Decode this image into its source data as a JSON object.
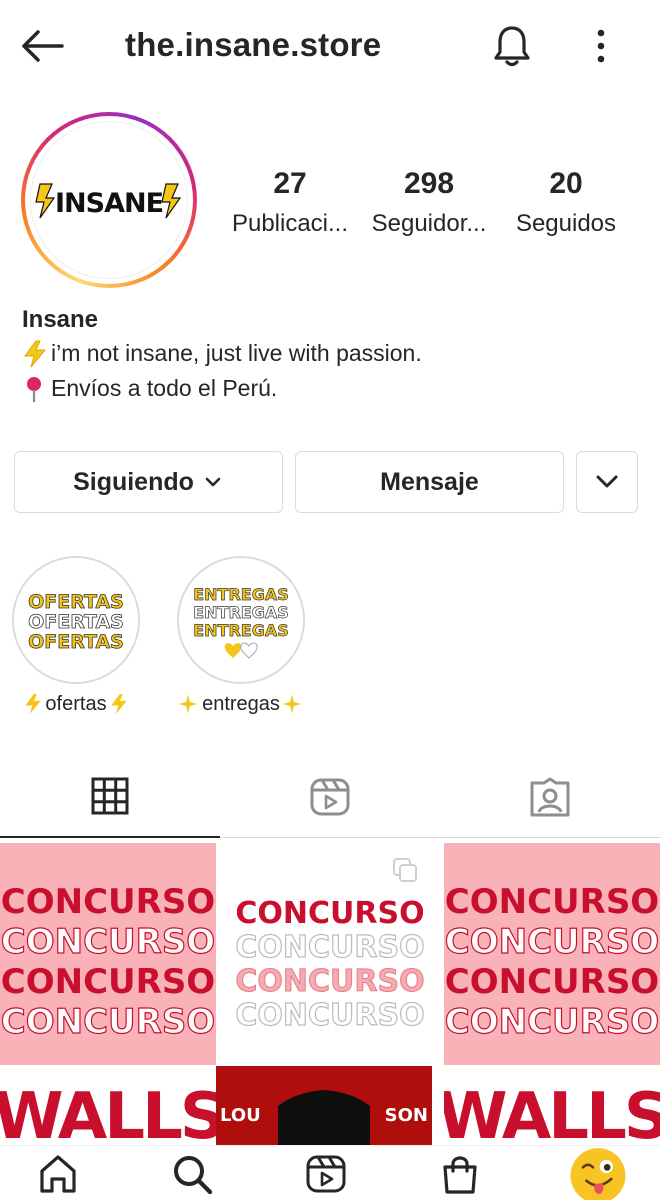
{
  "header": {
    "username": "the.insane.store"
  },
  "profile": {
    "avatar_text": "INSANE",
    "stats": [
      {
        "value": "27",
        "label": "Publicaci..."
      },
      {
        "value": "298",
        "label": "Seguidor..."
      },
      {
        "value": "20",
        "label": "Seguidos"
      }
    ],
    "name": "Insane",
    "bio_line_1": "i’m not insane, just live with passion.",
    "bio_line_2": "Envíos a todo el Perú."
  },
  "buttons": {
    "following": "Siguiendo",
    "message": "Mensaje"
  },
  "highlights": [
    {
      "label": "ofertas",
      "cover_text": "OFERTAS"
    },
    {
      "label": "entregas",
      "cover_text": "ENTREGAS"
    }
  ],
  "tabs": [
    "grid-icon",
    "reels-icon",
    "tagged-icon"
  ],
  "posts": [
    {
      "text": "CONCURSO"
    },
    {
      "text": "CONCURSO"
    },
    {
      "text": "CONCURSO"
    }
  ],
  "posts_row2": [
    {
      "text": "WALLS"
    },
    {
      "text_left": "LOU",
      "text_right": "SON"
    },
    {
      "text": "WALLS"
    }
  ],
  "bottom_nav": [
    "home-icon",
    "search-icon",
    "reels-icon",
    "shop-icon",
    "profile-emoji-icon"
  ],
  "colors": {
    "accent_red": "#c8102e",
    "pink_bg": "#f9b3b8",
    "yellow": "#f5c518",
    "text": "#262626",
    "border": "#dbdbdb"
  }
}
